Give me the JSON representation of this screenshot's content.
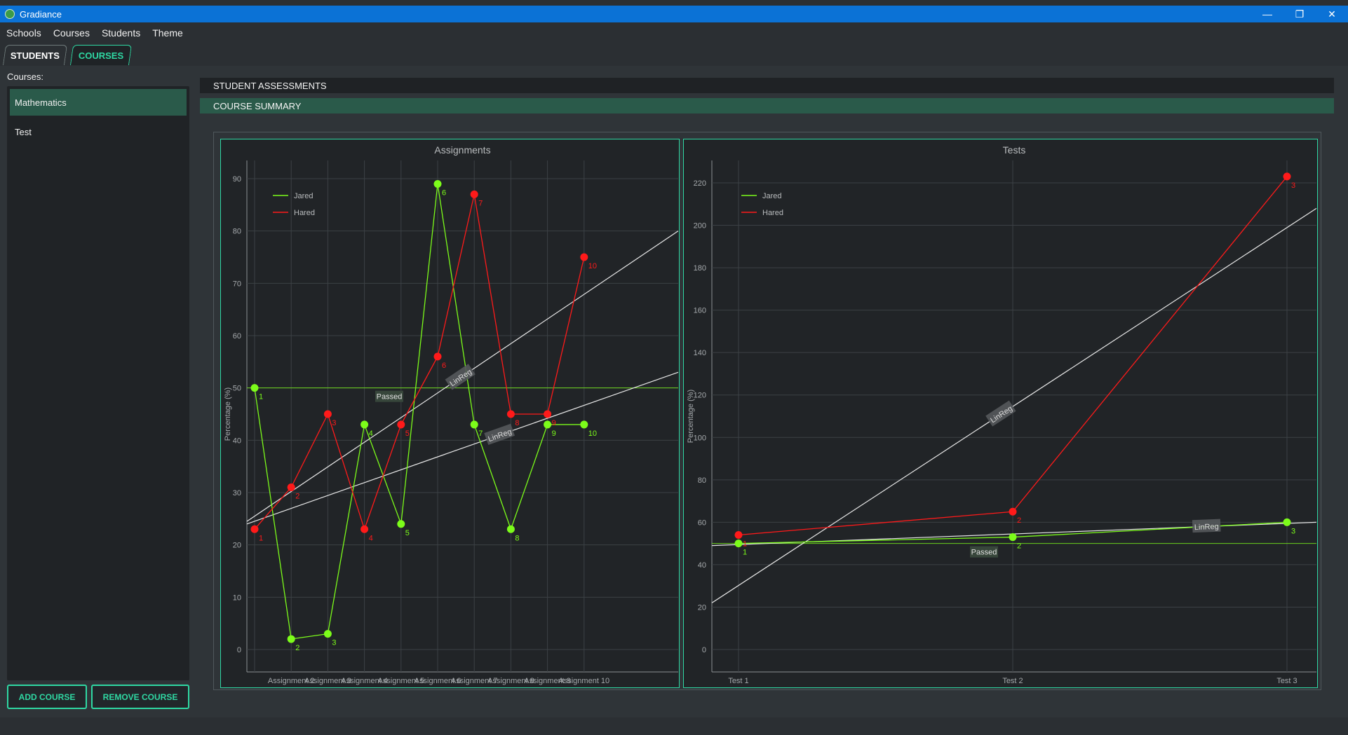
{
  "window": {
    "title": "Gradiance"
  },
  "menu": [
    "Schools",
    "Courses",
    "Students",
    "Theme"
  ],
  "tabs": {
    "students": "STUDENTS",
    "courses": "COURSES"
  },
  "sidebar": {
    "label": "Courses:",
    "courses": [
      {
        "name": "Mathematics",
        "selected": true
      },
      {
        "name": "Test",
        "selected": false
      }
    ],
    "add_button": "ADD COURSE",
    "remove_button": "REMOVE COURSE"
  },
  "sections": {
    "assessments": "STUDENT ASSESSMENTS",
    "summary": "COURSE SUMMARY"
  },
  "colors": {
    "accent": "#2fd8a3",
    "jared": "#7cfc1a",
    "hared": "#ff1a1a",
    "titlebar": "#0b72d6"
  },
  "chart_data": [
    {
      "type": "line",
      "title": "Assignments",
      "ylabel": "Percentage (%)",
      "categories": [
        "Assignment 1",
        "Assignment 2",
        "Assignment 3",
        "Assignment 4",
        "Assignment 5",
        "Assignment 6",
        "Assignment 7",
        "Assignment 8",
        "Assignment 9",
        "Assignment 10"
      ],
      "tick_labels": [
        "Assignment 2",
        "Assignment 3",
        "Assignment 4",
        "Assignment 5",
        "Assignment 6",
        "Assignment 7",
        "Assignment 8",
        "Assignment 9",
        "Assignment 10"
      ],
      "ylim": [
        0,
        90
      ],
      "yticks": [
        0,
        10,
        20,
        30,
        40,
        50,
        60,
        70,
        80,
        90
      ],
      "series": [
        {
          "name": "Jared",
          "color": "#7cfc1a",
          "values": [
            50,
            2,
            3,
            43,
            24,
            89,
            43,
            23,
            43,
            43
          ],
          "labels": [
            "1",
            "2",
            "3",
            "4",
            "5",
            "6",
            "7",
            "8",
            "9",
            "10"
          ]
        },
        {
          "name": "Hared",
          "color": "#ff1a1a",
          "values": [
            23,
            31,
            45,
            23,
            43,
            56,
            87,
            45,
            45,
            75
          ],
          "labels": [
            "1",
            "2",
            "3",
            "4",
            "5",
            "6",
            "7",
            "8",
            "9",
            "10"
          ]
        }
      ],
      "pass_line": 50,
      "pass_label": "Passed",
      "regressions": [
        {
          "label": "LinReg",
          "y_at_start": 24.5,
          "y_at_end": 80,
          "label_value": 52
        },
        {
          "label": "LinReg",
          "y_at_start": 24,
          "y_at_end": 53,
          "label_value": 41
        }
      ],
      "legend": "top-left",
      "grid": true
    },
    {
      "type": "line",
      "title": "Tests",
      "ylabel": "Percentage (%)",
      "categories": [
        "Test 1",
        "Test 2",
        "Test 3"
      ],
      "ylim": [
        0,
        220
      ],
      "yticks": [
        0,
        20,
        40,
        60,
        80,
        100,
        120,
        140,
        160,
        180,
        200,
        220
      ],
      "series": [
        {
          "name": "Jared",
          "color": "#7cfc1a",
          "values": [
            50,
            53,
            60
          ],
          "labels": [
            "1",
            "2",
            "3"
          ]
        },
        {
          "name": "Hared",
          "color": "#ff1a1a",
          "values": [
            54,
            65,
            223
          ],
          "labels": [
            "1",
            "2",
            "3"
          ]
        }
      ],
      "pass_line": 50,
      "pass_label": "Passed",
      "regressions": [
        {
          "label": "LinReg",
          "y_at_start": 22,
          "y_at_end": 208,
          "label_value": 111
        },
        {
          "label": "LinReg",
          "y_at_start": 49,
          "y_at_end": 60,
          "label_value": 58
        }
      ],
      "legend": "top-left",
      "grid": true
    }
  ]
}
